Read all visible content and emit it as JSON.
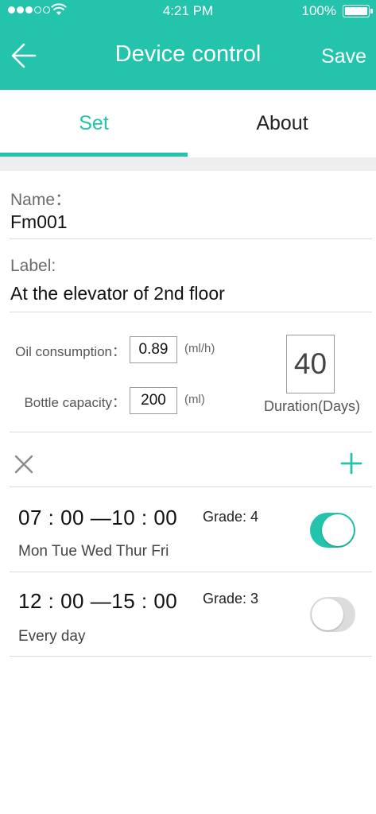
{
  "status_bar": {
    "time": "4:21 PM",
    "battery": "100%"
  },
  "header": {
    "title": "Device control",
    "save_label": "Save",
    "back_icon": "arrow-left-icon"
  },
  "tabs": [
    {
      "label": "Set",
      "active": true
    },
    {
      "label": "About",
      "active": false
    }
  ],
  "device": {
    "name_label": "Name：",
    "name_value": "Fm001",
    "label_label": "Label:",
    "label_value": "At the elevator of 2nd floor"
  },
  "params": {
    "oil_label": "Oil consumption：",
    "oil_value": "0.89",
    "oil_unit": "(ml/h)",
    "bottle_label": "Bottle capacity：",
    "bottle_value": "200",
    "bottle_unit": "(ml)",
    "duration_value": "40",
    "duration_label": "Duration(Days)"
  },
  "schedules": [
    {
      "time": "07 : 00 —10 : 00",
      "grade": "Grade:  4",
      "days": "Mon  Tue  Wed  Thur  Fri",
      "enabled": true
    },
    {
      "time": "12 : 00 —15 : 00",
      "grade": "Grade:  3",
      "days": "Every day",
      "enabled": false
    }
  ],
  "colors": {
    "accent": "#24c4ac",
    "toggle_off": "#dcdcdc",
    "section_gap": "#eeeeee"
  }
}
